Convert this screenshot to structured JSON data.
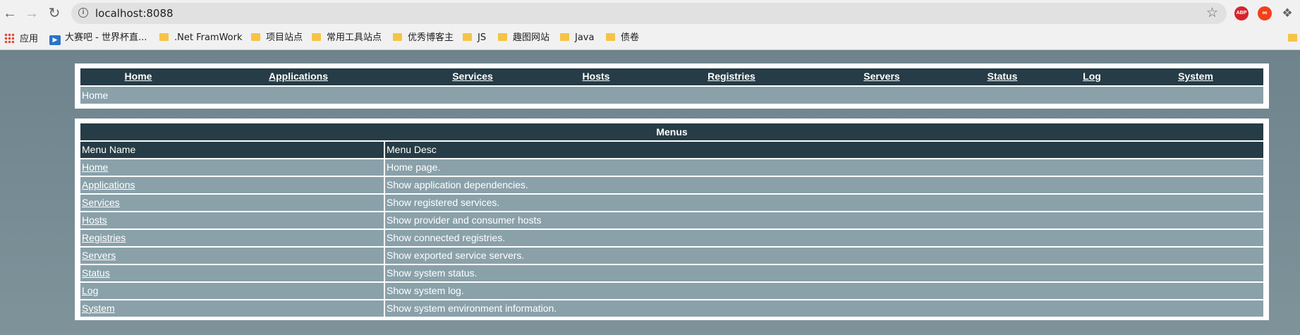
{
  "browser": {
    "url": "localhost:8088",
    "bookmarks": [
      {
        "label": "应用",
        "icon": "apps-grid-icon"
      },
      {
        "label": "大赛吧 - 世界杯直...",
        "icon": "tv-icon"
      },
      {
        "label": ".Net FramWork",
        "icon": "folder-icon"
      },
      {
        "label": "项目站点",
        "icon": "folder-icon"
      },
      {
        "label": "常用工具站点",
        "icon": "folder-icon"
      },
      {
        "label": "优秀博客主",
        "icon": "folder-icon"
      },
      {
        "label": "JS",
        "icon": "folder-icon"
      },
      {
        "label": "趣图网站",
        "icon": "folder-icon"
      },
      {
        "label": "Java",
        "icon": "folder-icon"
      },
      {
        "label": "债卷",
        "icon": "folder-icon"
      }
    ],
    "extensions": {
      "abp": "ABP",
      "loop": "∞"
    }
  },
  "nav": {
    "links": [
      "Home",
      "Applications",
      "Services",
      "Hosts",
      "Registries",
      "Servers",
      "Status",
      "Log",
      "System"
    ],
    "breadcrumb": "Home"
  },
  "menus": {
    "title": "Menus",
    "headers": [
      "Menu Name",
      "Menu Desc"
    ],
    "rows": [
      {
        "name": "Home",
        "desc": "Home page."
      },
      {
        "name": "Applications",
        "desc": "Show application dependencies."
      },
      {
        "name": "Services",
        "desc": "Show registered services."
      },
      {
        "name": "Hosts",
        "desc": "Show provider and consumer hosts"
      },
      {
        "name": "Registries",
        "desc": "Show connected registries."
      },
      {
        "name": "Servers",
        "desc": "Show exported service servers."
      },
      {
        "name": "Status",
        "desc": "Show system status."
      },
      {
        "name": "Log",
        "desc": "Show system log."
      },
      {
        "name": "System",
        "desc": "Show system environment information."
      }
    ]
  },
  "colors": {
    "header_bg": "#263c46",
    "row_bg": "#8aa1aa",
    "page_bg": "#6e838c"
  }
}
